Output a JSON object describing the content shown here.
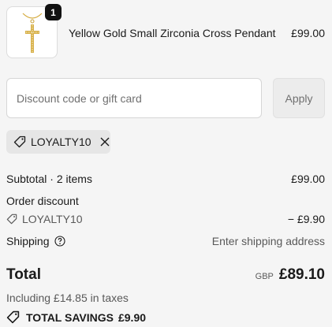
{
  "product": {
    "quantity": "1",
    "name": "Yellow Gold Small Zirconia Cross Pendant",
    "price": "£99.00",
    "image_icon": "cross-pendant"
  },
  "discount": {
    "placeholder": "Discount code or gift card",
    "value": "",
    "apply_label": "Apply"
  },
  "applied_code": {
    "code": "LOYALTY10",
    "tag_icon": "tag-icon",
    "remove_icon": "close-icon"
  },
  "summary": {
    "subtotal_label": "Subtotal · 2 items",
    "subtotal_value": "£99.00",
    "order_discount_label": "Order discount",
    "discount_code": "LOYALTY10",
    "discount_value": "− £9.90",
    "shipping_label": "Shipping",
    "shipping_value": "Enter shipping address",
    "total_label": "Total",
    "currency": "GBP",
    "total_value": "£89.10",
    "taxes_note": "Including £14.85 in taxes",
    "savings_label": "TOTAL SAVINGS",
    "savings_value": "£9.90"
  },
  "colors": {
    "background": "#f5f5f5",
    "text": "#1a1a1a",
    "muted": "#595959",
    "badge": "#111111",
    "chip": "#e6e6e6"
  }
}
